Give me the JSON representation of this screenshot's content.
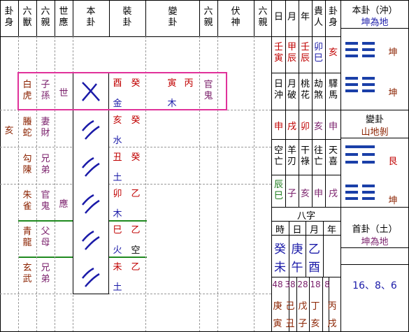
{
  "header": {
    "gua_shen": "卦身",
    "liu_shou": "六獸",
    "liu_qin": "六親",
    "shi_ying": "世應",
    "ben_gua": "本卦",
    "zhuang_gua": "裝卦",
    "bian_gua": "變卦",
    "liu_qin2": "六親",
    "fu_shen": "伏神",
    "liu_qin3": "六親",
    "day": "日",
    "month": "月",
    "year": "年",
    "gui_ren": "貴人",
    "gua_shen2": "卦身"
  },
  "rows": [
    {
      "gua_shen": "",
      "beast": "白虎",
      "qin": "子孫",
      "shiying": "世",
      "line": "old_yin",
      "zhuang_top": "酉",
      "zhuang_top2": "癸",
      "zhuang_bottom": "金",
      "bian_top": "寅",
      "bian_top2": "丙",
      "bian_bottom": "木",
      "bian_qin": "官鬼"
    },
    {
      "gua_shen": "亥",
      "beast": "螣蛇",
      "qin": "妻財",
      "shiying": "",
      "line": "yin",
      "zhuang_top": "亥",
      "zhuang_top2": "癸",
      "zhuang_bottom": "水",
      "bian_top": "",
      "bian_top2": "",
      "bian_bottom": "",
      "bian_qin": ""
    },
    {
      "gua_shen": "",
      "beast": "勾陳",
      "qin": "兄弟",
      "shiying": "",
      "line": "yin",
      "zhuang_top": "丑",
      "zhuang_top2": "癸",
      "zhuang_bottom": "土",
      "bian_top": "",
      "bian_top2": "",
      "bian_bottom": "",
      "bian_qin": ""
    },
    {
      "gua_shen": "",
      "beast": "朱雀",
      "qin": "官鬼",
      "shiying": "應",
      "line": "yin",
      "zhuang_top": "卯",
      "zhuang_top2": "乙",
      "zhuang_bottom": "木",
      "bian_top": "",
      "bian_top2": "",
      "bian_bottom": "",
      "bian_qin": ""
    },
    {
      "gua_shen": "",
      "beast": "青龍",
      "qin": "父母",
      "shiying": "",
      "line": "yin",
      "zhuang_top": "巳",
      "zhuang_top2": "乙",
      "zhuang_bottom": "火",
      "bian_top": "",
      "bian_top2": "",
      "bian_bottom": "",
      "bian_qin": "",
      "fu": "空"
    },
    {
      "gua_shen": "",
      "beast": "玄武",
      "qin": "兄弟",
      "shiying": "",
      "line": "yin",
      "zhuang_top": "未",
      "zhuang_top2": "乙",
      "zhuang_bottom": "土",
      "bian_top": "",
      "bian_top2": "",
      "bian_bottom": "",
      "bian_qin": ""
    }
  ],
  "info_grid": {
    "r1": [
      "壬寅",
      "甲辰",
      "壬辰",
      "卯巳",
      "亥"
    ],
    "r2": [
      "日沖",
      "月破",
      "桃花",
      "劫煞",
      "驛馬"
    ],
    "r3": [
      "申",
      "戌",
      "卯",
      "亥",
      "申"
    ],
    "r4": [
      "空亡",
      "羊刃",
      "干祿",
      "往亡",
      "天喜"
    ],
    "r5": [
      "辰巳",
      "子",
      "亥",
      "申",
      "戌"
    ]
  },
  "ben_panel": {
    "title": "本卦（沖）",
    "name": "坤為地",
    "upper": "坤",
    "lower": "坤"
  },
  "bian_panel": {
    "title": "變卦",
    "name": "山地剝",
    "upper": "艮",
    "lower": "坤"
  },
  "bazi": {
    "title": "八字",
    "heads": [
      "時",
      "日",
      "月",
      "年"
    ],
    "stems": [
      "癸",
      "庚",
      "乙",
      ""
    ],
    "branches": [
      "未",
      "午",
      "酉",
      ""
    ]
  },
  "shou_gua": {
    "title": "首卦（土）",
    "name": "坤為地",
    "numbers": "16、8、6"
  },
  "dayun": {
    "ages": [
      "48",
      "38",
      "28",
      "18",
      "8"
    ],
    "stems": [
      "庚",
      "己",
      "戊",
      "丁",
      "丙"
    ],
    "branches": [
      "寅",
      "丑",
      "子",
      "亥",
      "戌"
    ]
  }
}
